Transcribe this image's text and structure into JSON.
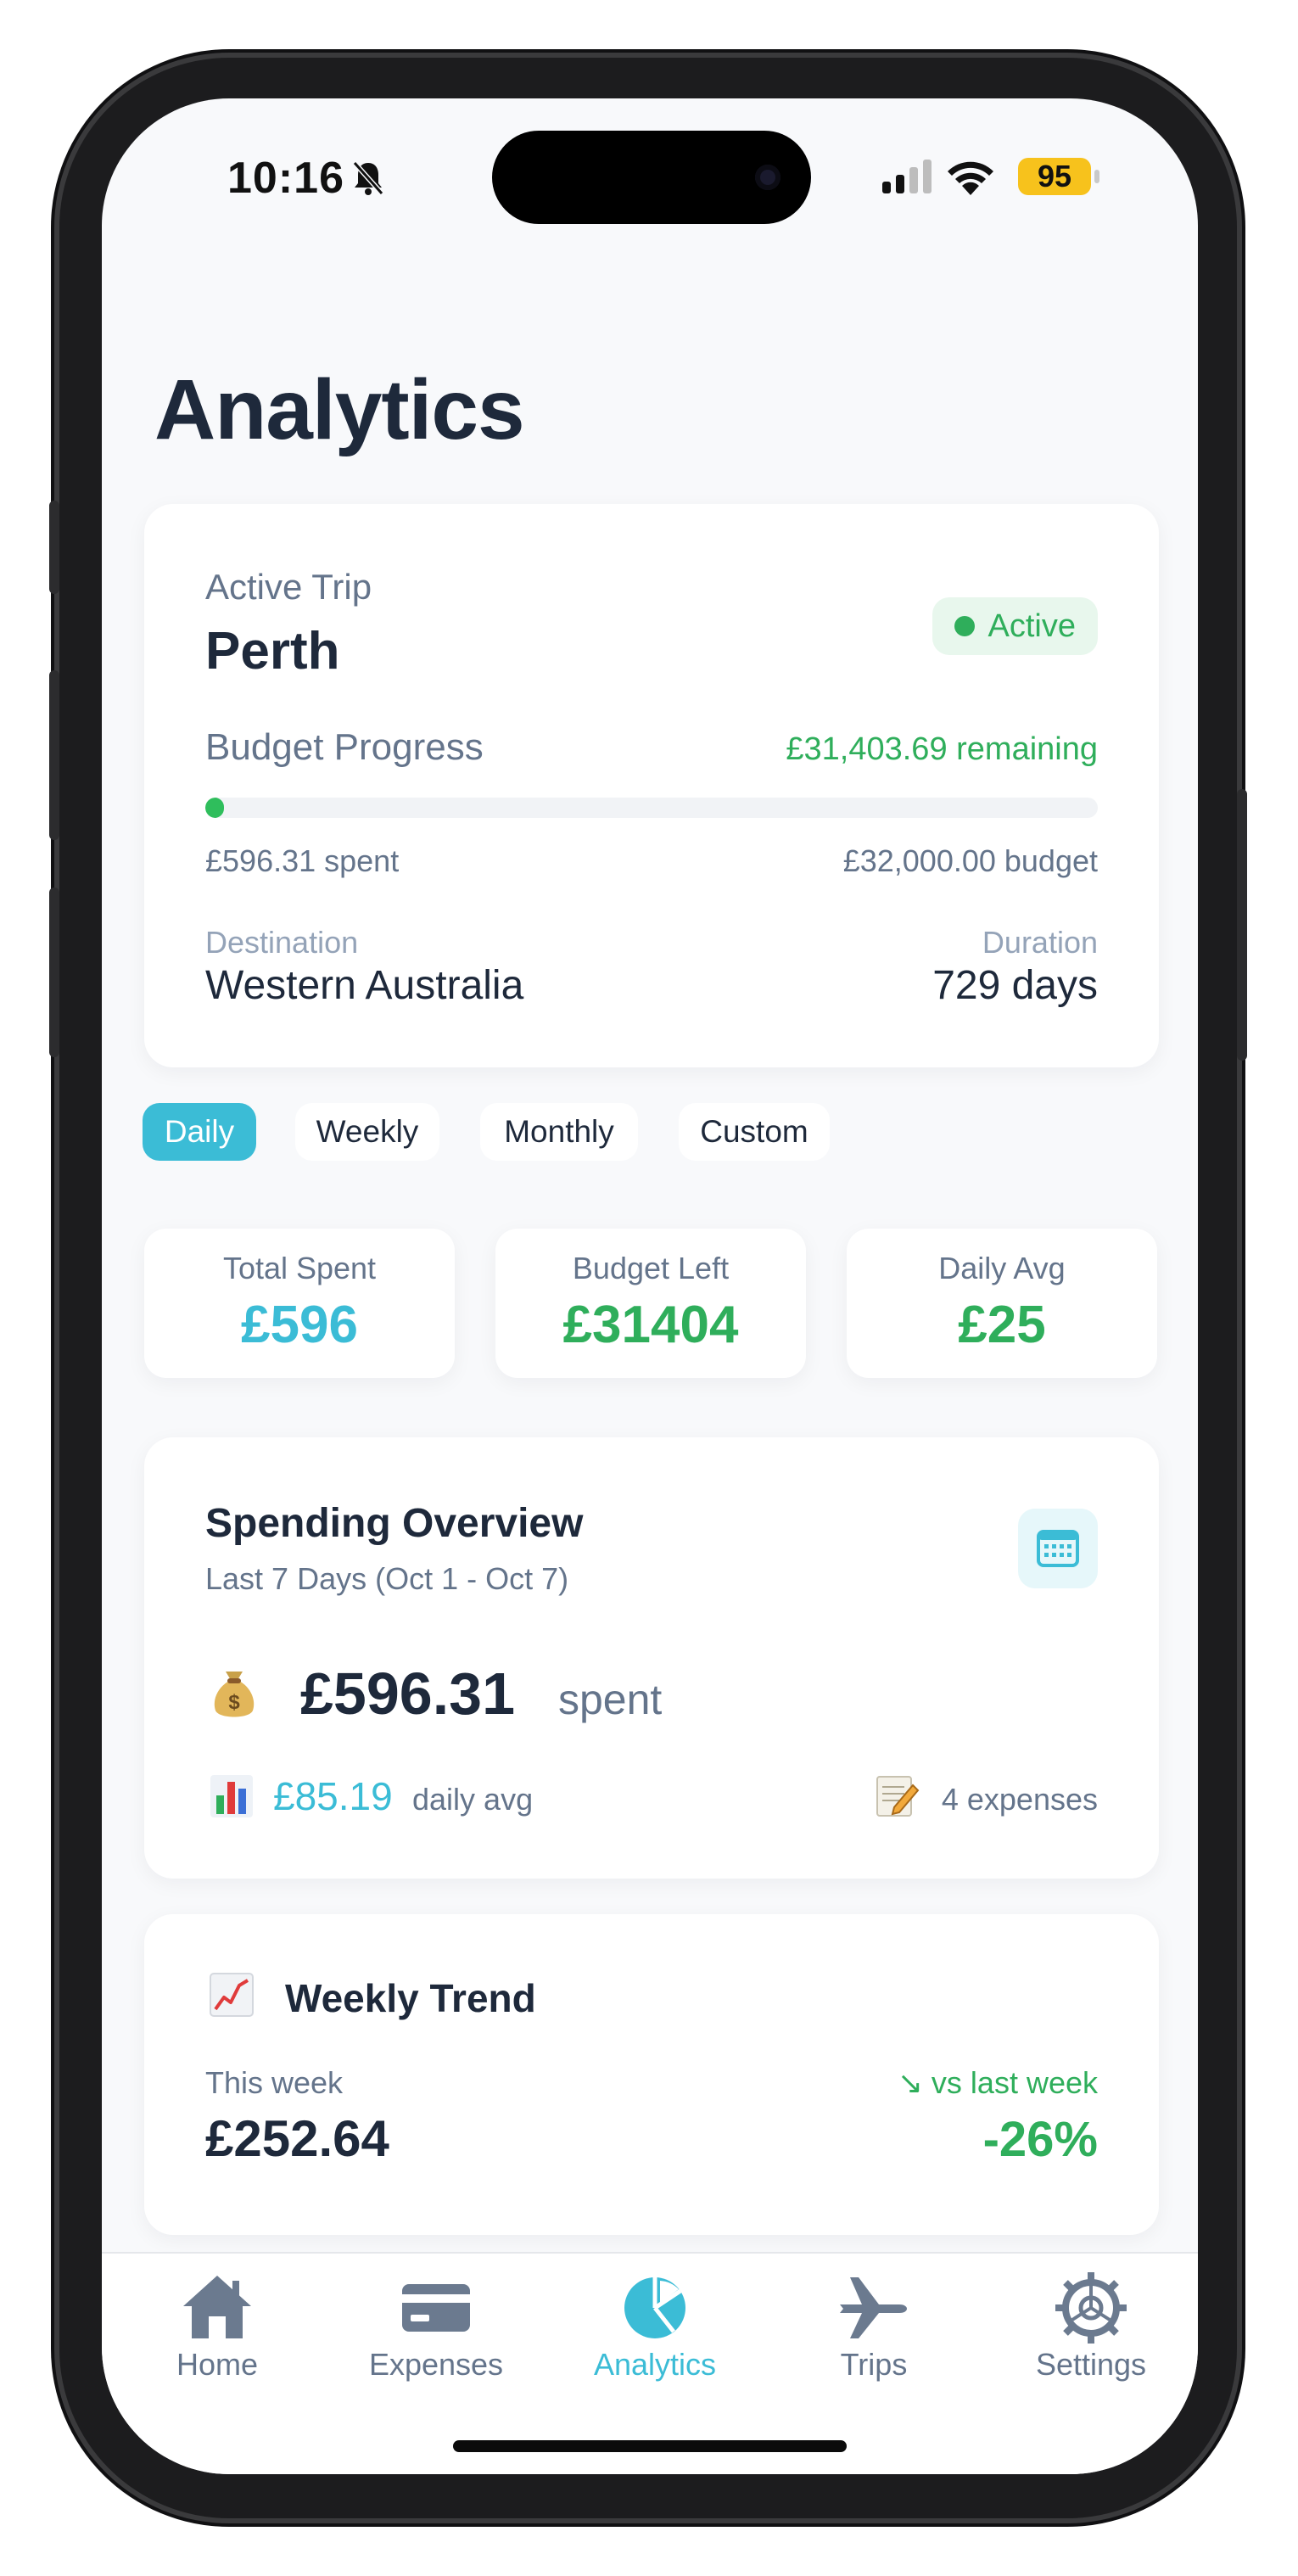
{
  "status_bar": {
    "time": "10:16",
    "battery": "95"
  },
  "page_title": "Analytics",
  "trip": {
    "label": "Active Trip",
    "city": "Perth",
    "status": "Active",
    "budget_progress_label": "Budget Progress",
    "remaining": "£31,403.69 remaining",
    "spent": "£596.31 spent",
    "budget": "£32,000.00 budget",
    "progress_fraction": 0.0186,
    "destination_label": "Destination",
    "destination": "Western Australia",
    "duration_label": "Duration",
    "duration": "729 days"
  },
  "period_tabs": [
    {
      "label": "Daily",
      "selected": true
    },
    {
      "label": "Weekly",
      "selected": false
    },
    {
      "label": "Monthly",
      "selected": false
    },
    {
      "label": "Custom",
      "selected": false
    }
  ],
  "stats": [
    {
      "label": "Total Spent",
      "value": "£596",
      "color": "#3bbcd6"
    },
    {
      "label": "Budget Left",
      "value": "£31404",
      "color": "#2fae5b"
    },
    {
      "label": "Daily Avg",
      "value": "£25",
      "color": "#2fae5b"
    }
  ],
  "overview": {
    "title": "Spending Overview",
    "subtitle": "Last 7 Days (Oct 1 - Oct 7)",
    "amount": "£596.31",
    "amount_suffix": "spent",
    "daily_avg": "£85.19",
    "daily_avg_label": "daily avg",
    "expenses": "4 expenses"
  },
  "weekly_trend": {
    "title": "Weekly Trend",
    "this_week_label": "This week",
    "this_week_value": "£252.64",
    "compare_label": "↘ vs last week",
    "change": "-26%"
  },
  "nav": [
    {
      "label": "Home",
      "icon": "home-icon",
      "selected": false
    },
    {
      "label": "Expenses",
      "icon": "card-icon",
      "selected": false
    },
    {
      "label": "Analytics",
      "icon": "pie-chart-icon",
      "selected": true
    },
    {
      "label": "Trips",
      "icon": "airplane-icon",
      "selected": false
    },
    {
      "label": "Settings",
      "icon": "gear-icon",
      "selected": false
    }
  ],
  "colors": {
    "accent": "#3bbcd6",
    "success": "#2fae5b",
    "text": "#1e293b",
    "muted": "#64748b"
  }
}
